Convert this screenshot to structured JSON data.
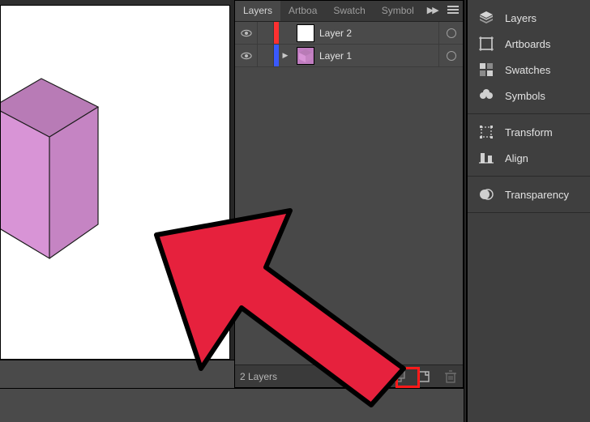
{
  "panel": {
    "tabs": [
      "Layers",
      "Artboa",
      "Swatch",
      "Symbol"
    ],
    "active_tab_index": 0,
    "footer_count": "2 Layers"
  },
  "layers": [
    {
      "name": "Layer 2",
      "color": "#ff3030",
      "thumb_fill": "#ffffff",
      "thumb_kind": "blank",
      "expandable": false
    },
    {
      "name": "Layer 1",
      "color": "#3959ff",
      "thumb_fill": "#c07dc0",
      "thumb_kind": "cube",
      "expandable": true
    }
  ],
  "right_groups": [
    {
      "items": [
        {
          "icon": "layers",
          "label": "Layers"
        },
        {
          "icon": "artboards",
          "label": "Artboards"
        },
        {
          "icon": "swatches",
          "label": "Swatches"
        },
        {
          "icon": "symbols",
          "label": "Symbols"
        }
      ]
    },
    {
      "items": [
        {
          "icon": "transform",
          "label": "Transform"
        },
        {
          "icon": "align",
          "label": "Align"
        }
      ]
    },
    {
      "items": [
        {
          "icon": "transparency",
          "label": "Transparency"
        }
      ]
    }
  ],
  "cube": {
    "top": "#b87bb6",
    "left": "#d894d6",
    "right": "#c584c3"
  }
}
